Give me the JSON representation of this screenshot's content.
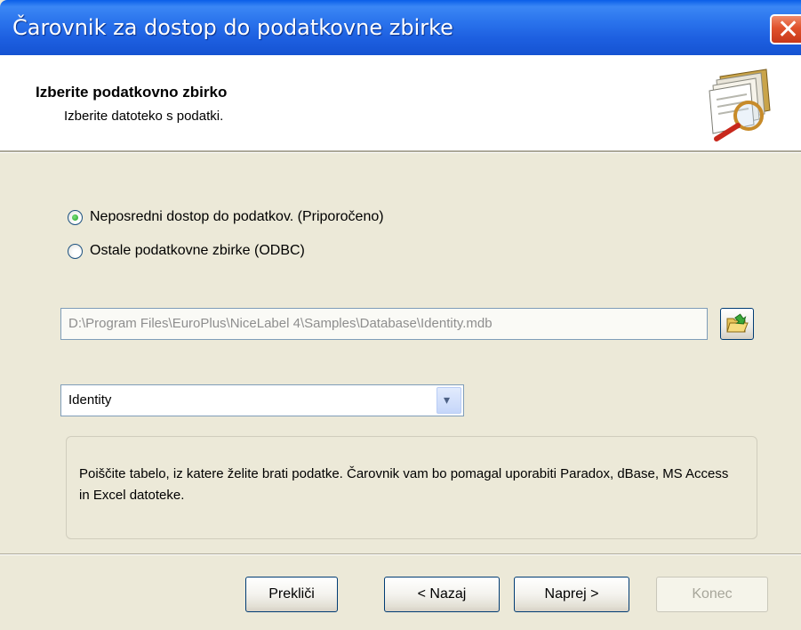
{
  "window": {
    "title": "Čarovnik za dostop do podatkovne zbirke",
    "close_glyph": "✕"
  },
  "header": {
    "title": "Izberite podatkovno zbirko",
    "subtitle": "Izberite datoteko s podatki.",
    "icon": "database-wizard-icon"
  },
  "options": {
    "direct_label": "Neposredni dostop do podatkov. (Priporočeno)",
    "direct_selected": true,
    "odbc_label": "Ostale podatkovne zbirke (ODBC)",
    "odbc_selected": false
  },
  "file": {
    "path": "D:\\Program Files\\EuroPlus\\NiceLabel 4\\Samples\\Database\\Identity.mdb",
    "browse_icon": "open-folder-icon"
  },
  "table_select": {
    "value": "Identity",
    "arrow_glyph": "▾"
  },
  "info": {
    "text": "Poiščite tabelo, iz katere želite brati podatke. Čarovnik vam bo pomagal uporabiti Paradox, dBase, MS Access in Excel datoteke."
  },
  "buttons": {
    "cancel": "Prekliči",
    "back": "< Nazaj",
    "next": "Naprej >",
    "finish": "Konec"
  },
  "colors": {
    "titlebar": "#1d5fe0",
    "dialog_bg": "#ece9d8",
    "close_button": "#e0522c",
    "disabled_text": "#a7a69a"
  }
}
